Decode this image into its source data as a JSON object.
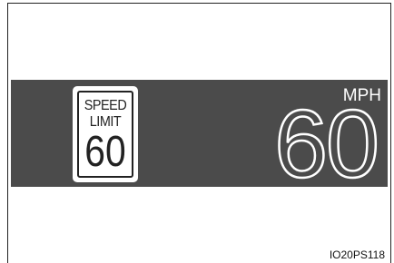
{
  "display": {
    "speed_limit_sign": {
      "line1": "SPEED",
      "line2": "LIMIT",
      "value": "60"
    },
    "current_speed": {
      "value": "60",
      "unit": "MPH"
    }
  },
  "caption": {
    "code": "IO20PS118"
  },
  "colors": {
    "display_band": "#4b4b4b",
    "text_light": "#ffffff",
    "text_dark": "#222222"
  }
}
